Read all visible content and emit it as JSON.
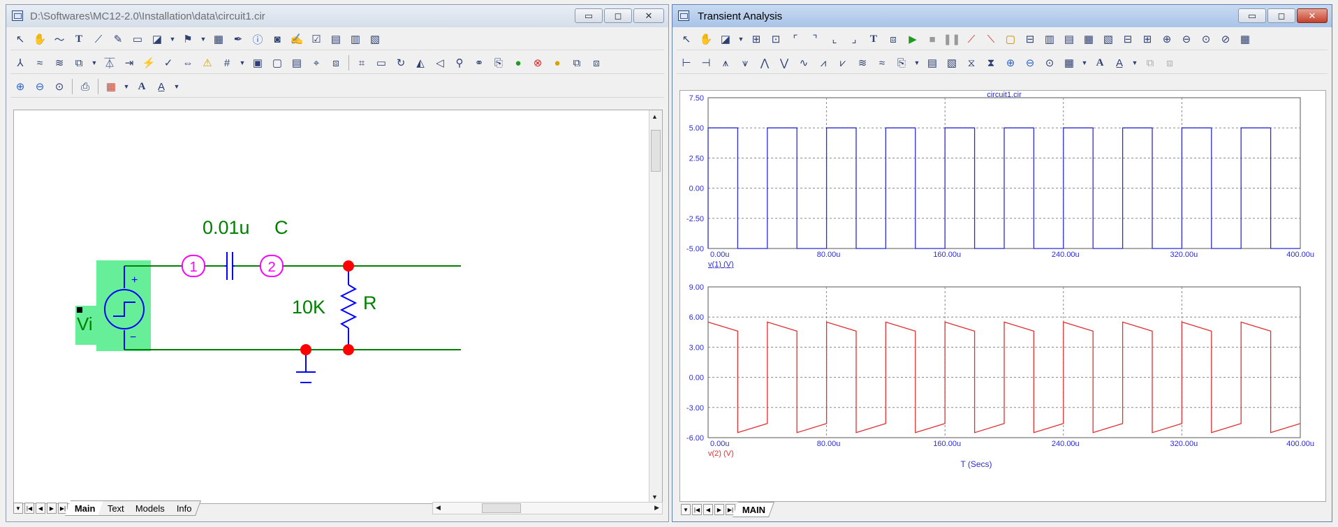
{
  "left_window": {
    "title": "D:\\Softwares\\MC12-2.0\\Installation\\data\\circuit1.cir",
    "controls": {
      "minimize": "▭",
      "maximize": "◻",
      "close": "✕"
    },
    "schematic": {
      "capacitor_value": "0.01u",
      "capacitor_name": "C",
      "node1": "1",
      "node2": "2",
      "resistor_value": "10K",
      "resistor_name": "R",
      "source_name": "Vi",
      "plus": "+",
      "minus": "−"
    },
    "tabs": [
      "Main",
      "Text",
      "Models",
      "Info"
    ]
  },
  "right_window": {
    "title": "Transient Analysis",
    "controls": {
      "minimize": "▭",
      "maximize": "◻",
      "close": "✕"
    },
    "tabs": [
      "MAIN"
    ],
    "xlabel": "T (Secs)"
  },
  "colors": {
    "wire": "#008000",
    "blue": "#0000ff",
    "red": "#ff0000",
    "magenta": "#ff00ff",
    "source_fill": "#66ee99",
    "plot1": "#2b2bd6",
    "plot2": "#e03030"
  },
  "chart_data": [
    {
      "type": "line",
      "title": "circuit1.cir",
      "xlabel": "",
      "ylabel": "v(1) (V)",
      "xlim": [
        0,
        400
      ],
      "ylim": [
        -5,
        7.5
      ],
      "xticks": [
        "0.00u",
        "80.00u",
        "160.00u",
        "240.00u",
        "320.00u",
        "400.00u"
      ],
      "yticks": [
        "7.50",
        "5.00",
        "2.50",
        "0.00",
        "-2.50",
        "-5.00"
      ],
      "grid": true,
      "series": [
        {
          "name": "v(1) (V)",
          "x": [
            0,
            0,
            20,
            20,
            40,
            40,
            60,
            60,
            80,
            80,
            100,
            100,
            120,
            120,
            140,
            140,
            160,
            160,
            180,
            180,
            200,
            200,
            220,
            220,
            240,
            240,
            260,
            260,
            280,
            280,
            300,
            300,
            320,
            320,
            340,
            340,
            360,
            360,
            380,
            380,
            400
          ],
          "y": [
            -5,
            5,
            5,
            -5,
            -5,
            5,
            5,
            -5,
            -5,
            5,
            5,
            -5,
            -5,
            5,
            5,
            -5,
            -5,
            5,
            5,
            -5,
            -5,
            5,
            5,
            -5,
            -5,
            5,
            5,
            -5,
            -5,
            5,
            5,
            -5,
            -5,
            5,
            5,
            -5,
            -5,
            5,
            5,
            -5,
            -5
          ]
        }
      ]
    },
    {
      "type": "line",
      "title": "",
      "xlabel": "T (Secs)",
      "ylabel": "v(2) (V)",
      "xlim": [
        0,
        400
      ],
      "ylim": [
        -6,
        9
      ],
      "xticks": [
        "0.00u",
        "80.00u",
        "160.00u",
        "240.00u",
        "320.00u",
        "400.00u"
      ],
      "yticks": [
        "9.00",
        "6.00",
        "3.00",
        "0.00",
        "-3.00",
        "-6.00"
      ],
      "grid": true,
      "series": [
        {
          "name": "v(2) (V)",
          "x": [
            0,
            20,
            20,
            40,
            40,
            60,
            60,
            80,
            80,
            100,
            100,
            120,
            120,
            140,
            140,
            160,
            160,
            180,
            180,
            200,
            200,
            220,
            220,
            240,
            240,
            260,
            260,
            280,
            280,
            300,
            300,
            320,
            320,
            340,
            340,
            360,
            360,
            380,
            380,
            400
          ],
          "y": [
            5.5,
            4.6,
            -5.5,
            -4.6,
            5.5,
            4.6,
            -5.5,
            -4.6,
            5.5,
            4.6,
            -5.5,
            -4.6,
            5.5,
            4.6,
            -5.5,
            -4.6,
            5.5,
            4.6,
            -5.5,
            -4.6,
            5.5,
            4.6,
            -5.5,
            -4.6,
            5.5,
            4.6,
            -5.5,
            -4.6,
            5.5,
            4.6,
            -5.5,
            -4.6,
            5.5,
            4.6,
            -5.5,
            -4.6,
            5.5,
            4.6,
            -5.5,
            -4.6
          ]
        }
      ]
    }
  ]
}
